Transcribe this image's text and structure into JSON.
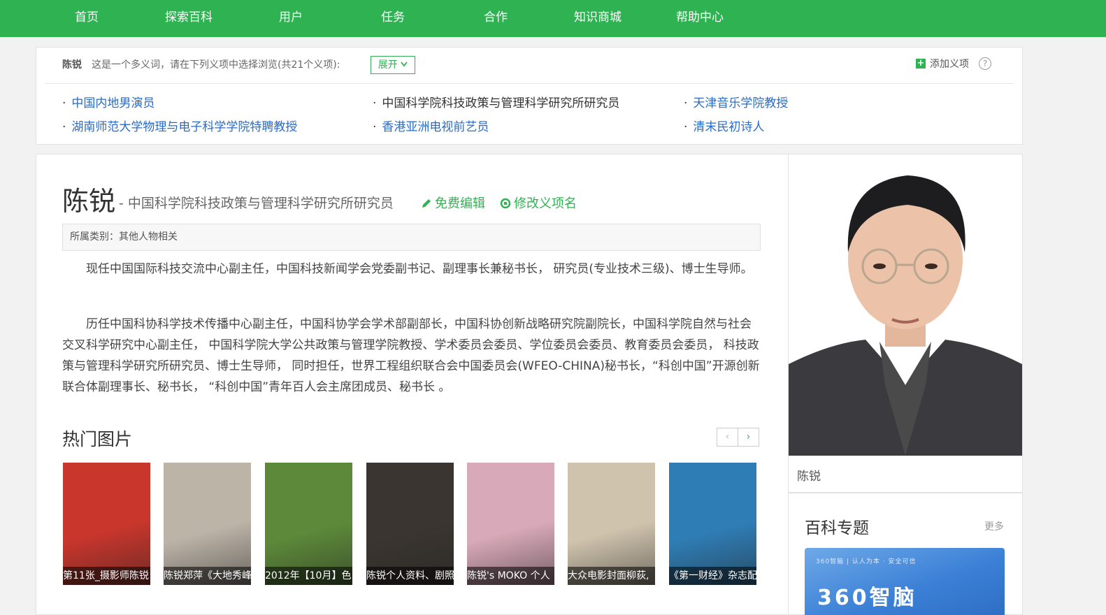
{
  "nav": {
    "items": [
      "首页",
      "探索百科",
      "用户",
      "任务",
      "合作",
      "知识商城",
      "帮助中心"
    ]
  },
  "disambiguation": {
    "name": "陈锐",
    "description": "这是一个多义词，请在下列义项中选择浏览(共21个义项):",
    "expand_label": "展开",
    "add_label": "添加义项",
    "items": [
      "中国内地男演员",
      "中国科学院科技政策与管理科学研究所研究员",
      "天津音乐学院教授",
      "湖南师范大学物理与电子科学学院特聘教授",
      "香港亚洲电视前艺员",
      "清末民初诗人"
    ]
  },
  "article": {
    "title": "陈锐",
    "subtitle": "- 中国科学院科技政策与管理科学研究所研究员",
    "edit_label": "免费编辑",
    "rename_label": "修改义项名",
    "category": "所属类别：其他人物相关",
    "paragraphs": [
      "现任中国国际科技交流中心副主任，中国科技新闻学会党委副书记、副理事长兼秘书长， 研究员(专业技术三级)、博士生导师。",
      "历任中国科协科学技术传播中心副主任，中国科协学会学术部副部长，中国科协创新战略研究院副院长，中国科学院自然与社会交叉科学研究中心副主任， 中国科学院大学公共政策与管理学院教授、学术委员会委员、学位委员会委员、教育委员会委员， 科技政策与管理科学研究所研究员、博士生导师， 同时担任，世界工程组织联合会中国委员会(WFEO-CHINA)秘书长，“科创中国”开源创新联合体副理事长、秘书长， “科创中国”青年百人会主席团成员、秘书长 。"
    ],
    "hot_images_title": "热门图片",
    "pager_prev": "‹",
    "pager_next": "›",
    "thumbs": [
      {
        "caption": "第11张_摄影师陈锐",
        "color": "#c8362c"
      },
      {
        "caption": "陈锐郑萍《大地秀峰",
        "color": "#bdb4a8"
      },
      {
        "caption": "2012年【10月】色",
        "color": "#5d8a3a"
      },
      {
        "caption": "陈锐个人资料、剧照",
        "color": "#3a3530"
      },
      {
        "caption": "陈锐's MOKO 个人",
        "color": "#d8a9b8"
      },
      {
        "caption": "大众电影封面柳荻,",
        "color": "#cfc3ad"
      },
      {
        "caption": "《第一财经》杂志配",
        "color": "#2f7db5"
      }
    ]
  },
  "sidebar": {
    "photo_name": "陈锐",
    "topics_title": "百科专题",
    "topics_more": "更多",
    "banner_small": "360智脑 | 认人为本 · 安全可信",
    "banner_big": "360智脑"
  }
}
